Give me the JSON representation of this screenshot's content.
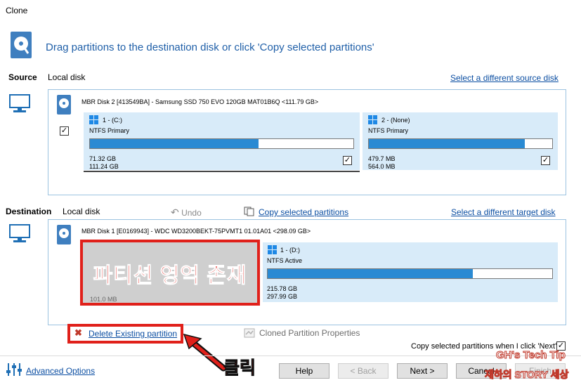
{
  "window": {
    "title": "Clone"
  },
  "header": {
    "instruction": "Drag partitions to the destination disk or click 'Copy selected partitions'"
  },
  "source": {
    "label": "Source",
    "type": "Local disk",
    "change_link": "Select a different source disk",
    "disk_title": "MBR Disk 2 [413549BA] - Samsung SSD 750 EVO 120GB MAT01B6Q  <111.79 GB>",
    "partitions": [
      {
        "name": "1 -  (C:)",
        "fs": "NTFS Primary",
        "used": "71.32 GB",
        "total": "111.24 GB",
        "fill": 0.64
      },
      {
        "name": "2 -  (None)",
        "fs": "NTFS Primary",
        "used": "479.7 MB",
        "total": "564.0 MB",
        "fill": 0.85
      }
    ]
  },
  "destination": {
    "label": "Destination",
    "type": "Local disk",
    "undo": "Undo",
    "copy_link": "Copy selected partitions",
    "change_link": "Select a different target disk",
    "disk_title": "MBR Disk 1 [E0169943] - WDC WD3200BEKT-75PVMT1 01.01A01  <298.09 GB>",
    "existing_size": "101.0 MB",
    "annotation_text": "파티션 영역 존재",
    "partition": {
      "name": "1 -  (D:)",
      "fs": "NTFS Active",
      "used": "215.78 GB",
      "total": "297.99 GB",
      "fill": 0.72
    }
  },
  "actions": {
    "delete_link": "Delete Existing partition",
    "cloned_props": "Cloned Partition Properties",
    "copy_on_next": "Copy selected partitions when I click 'Next'",
    "click_annotation": "클릭"
  },
  "footer": {
    "advanced": "Advanced Options",
    "help": "Help",
    "back": "< Back",
    "next": "Next >",
    "cancel": "Cancel",
    "finish": "Finish"
  },
  "watermark": {
    "line1": "GH's Tech Tip",
    "line2": "재하의 STORY 세상"
  },
  "colors": {
    "accent": "#2a8ad3",
    "annotation_red": "#e0201a",
    "link": "#0b4ea2"
  }
}
